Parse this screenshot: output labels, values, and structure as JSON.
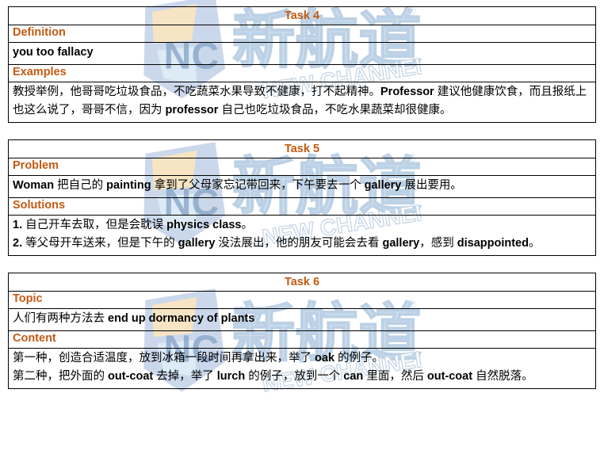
{
  "document": {
    "background_color": "#ffffff",
    "text_color": "#000000",
    "accent_color": "#C35A12",
    "border_color": "#000000"
  },
  "watermark": {
    "brand_cn": "新航道",
    "brand_en": "NEW CHANNEL",
    "logo_letters": "NC",
    "registered_mark": "®",
    "shield_color": "#c9d6ea",
    "text_color": "#cfe0ef",
    "accent_color": "#f7e3c0"
  },
  "tasks": [
    {
      "title": "Task 4",
      "rows": [
        {
          "label": "Definition",
          "lines": [
            [
              {
                "t": "you too fallacy",
                "en": true
              }
            ]
          ]
        },
        {
          "label": "Examples",
          "lines": [
            [
              {
                "t": "教授举例，他哥哥吃垃圾食品，不吃蔬菜水果导致不健康，打不起精神。",
                "en": false
              },
              {
                "t": "Professor",
                "en": true
              },
              {
                "t": " 建议他健康饮食，而且报纸上也这么说了，哥哥不信，因为 ",
                "en": false
              },
              {
                "t": "professor",
                "en": true
              },
              {
                "t": " 自己也吃垃圾食品，不吃水果蔬菜却很健康。",
                "en": false
              }
            ]
          ]
        }
      ]
    },
    {
      "title": "Task 5",
      "rows": [
        {
          "label": "Problem",
          "lines": [
            [
              {
                "t": "Woman",
                "en": true
              },
              {
                "t": " 把自己的 ",
                "en": false
              },
              {
                "t": "painting",
                "en": true
              },
              {
                "t": " 拿到了父母家忘记带回来，下午要去一个 ",
                "en": false
              },
              {
                "t": "gallery",
                "en": true
              },
              {
                "t": " 展出要用。",
                "en": false
              }
            ]
          ]
        },
        {
          "label": "Solutions",
          "lines": [
            [
              {
                "t": "1.",
                "en": true
              },
              {
                "t": " 自己开车去取，但是会耽误 ",
                "en": false
              },
              {
                "t": "physics class",
                "en": true
              },
              {
                "t": "。",
                "en": false
              }
            ],
            [
              {
                "t": "2.",
                "en": true
              },
              {
                "t": " 等父母开车送来，但是下午的 ",
                "en": false
              },
              {
                "t": "gallery",
                "en": true
              },
              {
                "t": " 没法展出，他的朋友可能会去看 ",
                "en": false
              },
              {
                "t": "gallery",
                "en": true
              },
              {
                "t": "，感到 ",
                "en": false
              },
              {
                "t": "disappointed",
                "en": true
              },
              {
                "t": "。",
                "en": false
              }
            ]
          ]
        }
      ]
    },
    {
      "title": "Task 6",
      "rows": [
        {
          "label": "Topic",
          "lines": [
            [
              {
                "t": "人们有两种方法去 ",
                "en": false
              },
              {
                "t": "end up dormancy of plants",
                "en": true
              }
            ]
          ]
        },
        {
          "label": "Content",
          "lines": [
            [
              {
                "t": "第一种，创造合适温度，放到冰箱一段时间再拿出来，举了 ",
                "en": false
              },
              {
                "t": "oak",
                "en": true
              },
              {
                "t": " 的例子。",
                "en": false
              }
            ],
            [
              {
                "t": "第二种，把外面的 ",
                "en": false
              },
              {
                "t": "out-coat",
                "en": true
              },
              {
                "t": " 去掉，举了 ",
                "en": false
              },
              {
                "t": "lurch",
                "en": true
              },
              {
                "t": " 的例子，放到一个 ",
                "en": false
              },
              {
                "t": "can",
                "en": true
              },
              {
                "t": " 里面，然后 ",
                "en": false
              },
              {
                "t": "out-coat",
                "en": true
              },
              {
                "t": " 自然脱落。",
                "en": false
              }
            ]
          ]
        }
      ]
    }
  ]
}
